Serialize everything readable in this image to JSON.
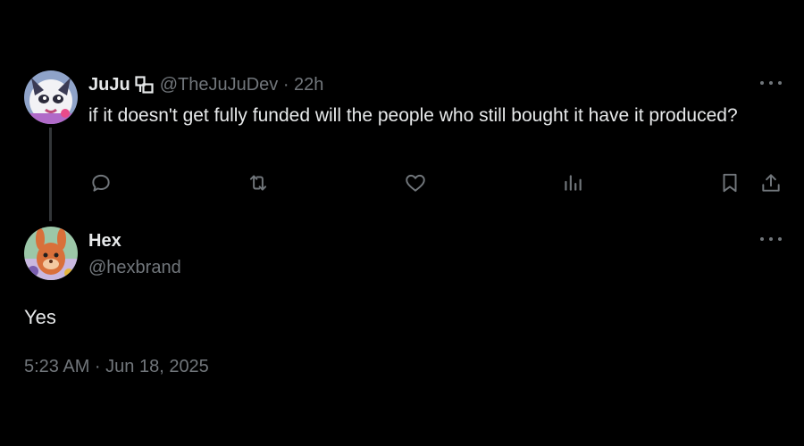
{
  "parent_tweet": {
    "author_name": "JuJu",
    "author_handle_time": "@TheJuJuDev · 22h",
    "text": "if it doesn't get fully funded will the people who still bought it have it produced?",
    "icons": {
      "affiliation": "affiliation-badge-icon",
      "more": "more-icon",
      "reply": "reply-icon",
      "repost": "repost-icon",
      "like": "like-icon",
      "views": "views-icon",
      "bookmark": "bookmark-icon",
      "share": "share-icon"
    }
  },
  "reply_tweet": {
    "author_name": "Hex",
    "author_handle": "@hexbrand",
    "text": "Yes",
    "timestamp": "5:23 AM · Jun 18, 2025"
  },
  "colors": {
    "background": "#000000",
    "primary_text": "#e7e9ea",
    "secondary_text": "#71767b",
    "thread_line": "#333639"
  }
}
